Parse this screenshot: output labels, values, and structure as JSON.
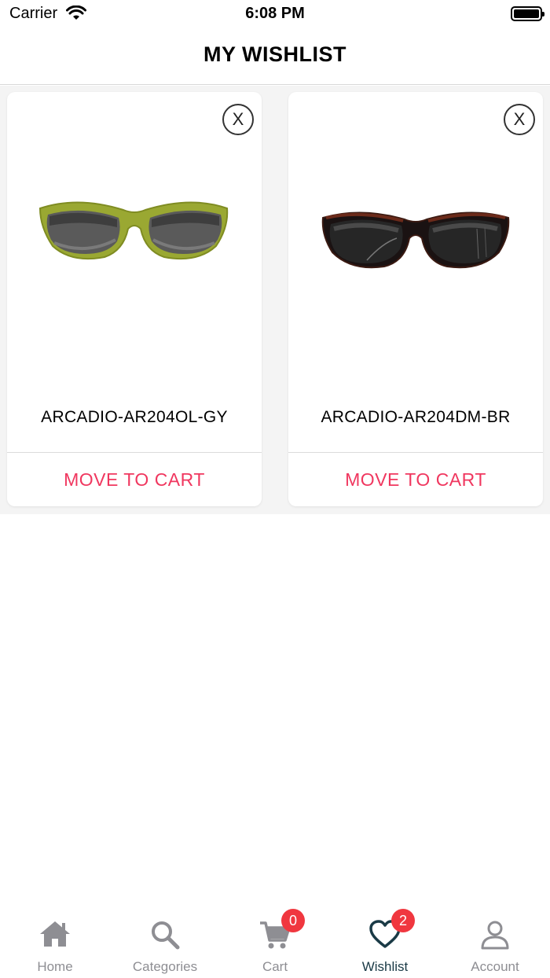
{
  "status_bar": {
    "carrier": "Carrier",
    "time": "6:08 PM"
  },
  "header": {
    "title": "MY WISHLIST"
  },
  "items": [
    {
      "name": "ARCADIO-AR204OL-GY",
      "action_label": "MOVE TO CART",
      "remove_label": "X"
    },
    {
      "name": "ARCADIO-AR204DM-BR",
      "action_label": "MOVE TO CART",
      "remove_label": "X"
    }
  ],
  "tabs": [
    {
      "label": "Home",
      "icon": "home-icon"
    },
    {
      "label": "Categories",
      "icon": "search-icon"
    },
    {
      "label": "Cart",
      "icon": "cart-icon",
      "badge": "0"
    },
    {
      "label": "Wishlist",
      "icon": "heart-icon",
      "badge": "2",
      "active": true
    },
    {
      "label": "Account",
      "icon": "user-icon"
    }
  ],
  "colors": {
    "accent": "#f0375f",
    "badge": "#f0373f",
    "active_tab": "#1a3a46",
    "inactive_tab": "#8e8e93"
  }
}
